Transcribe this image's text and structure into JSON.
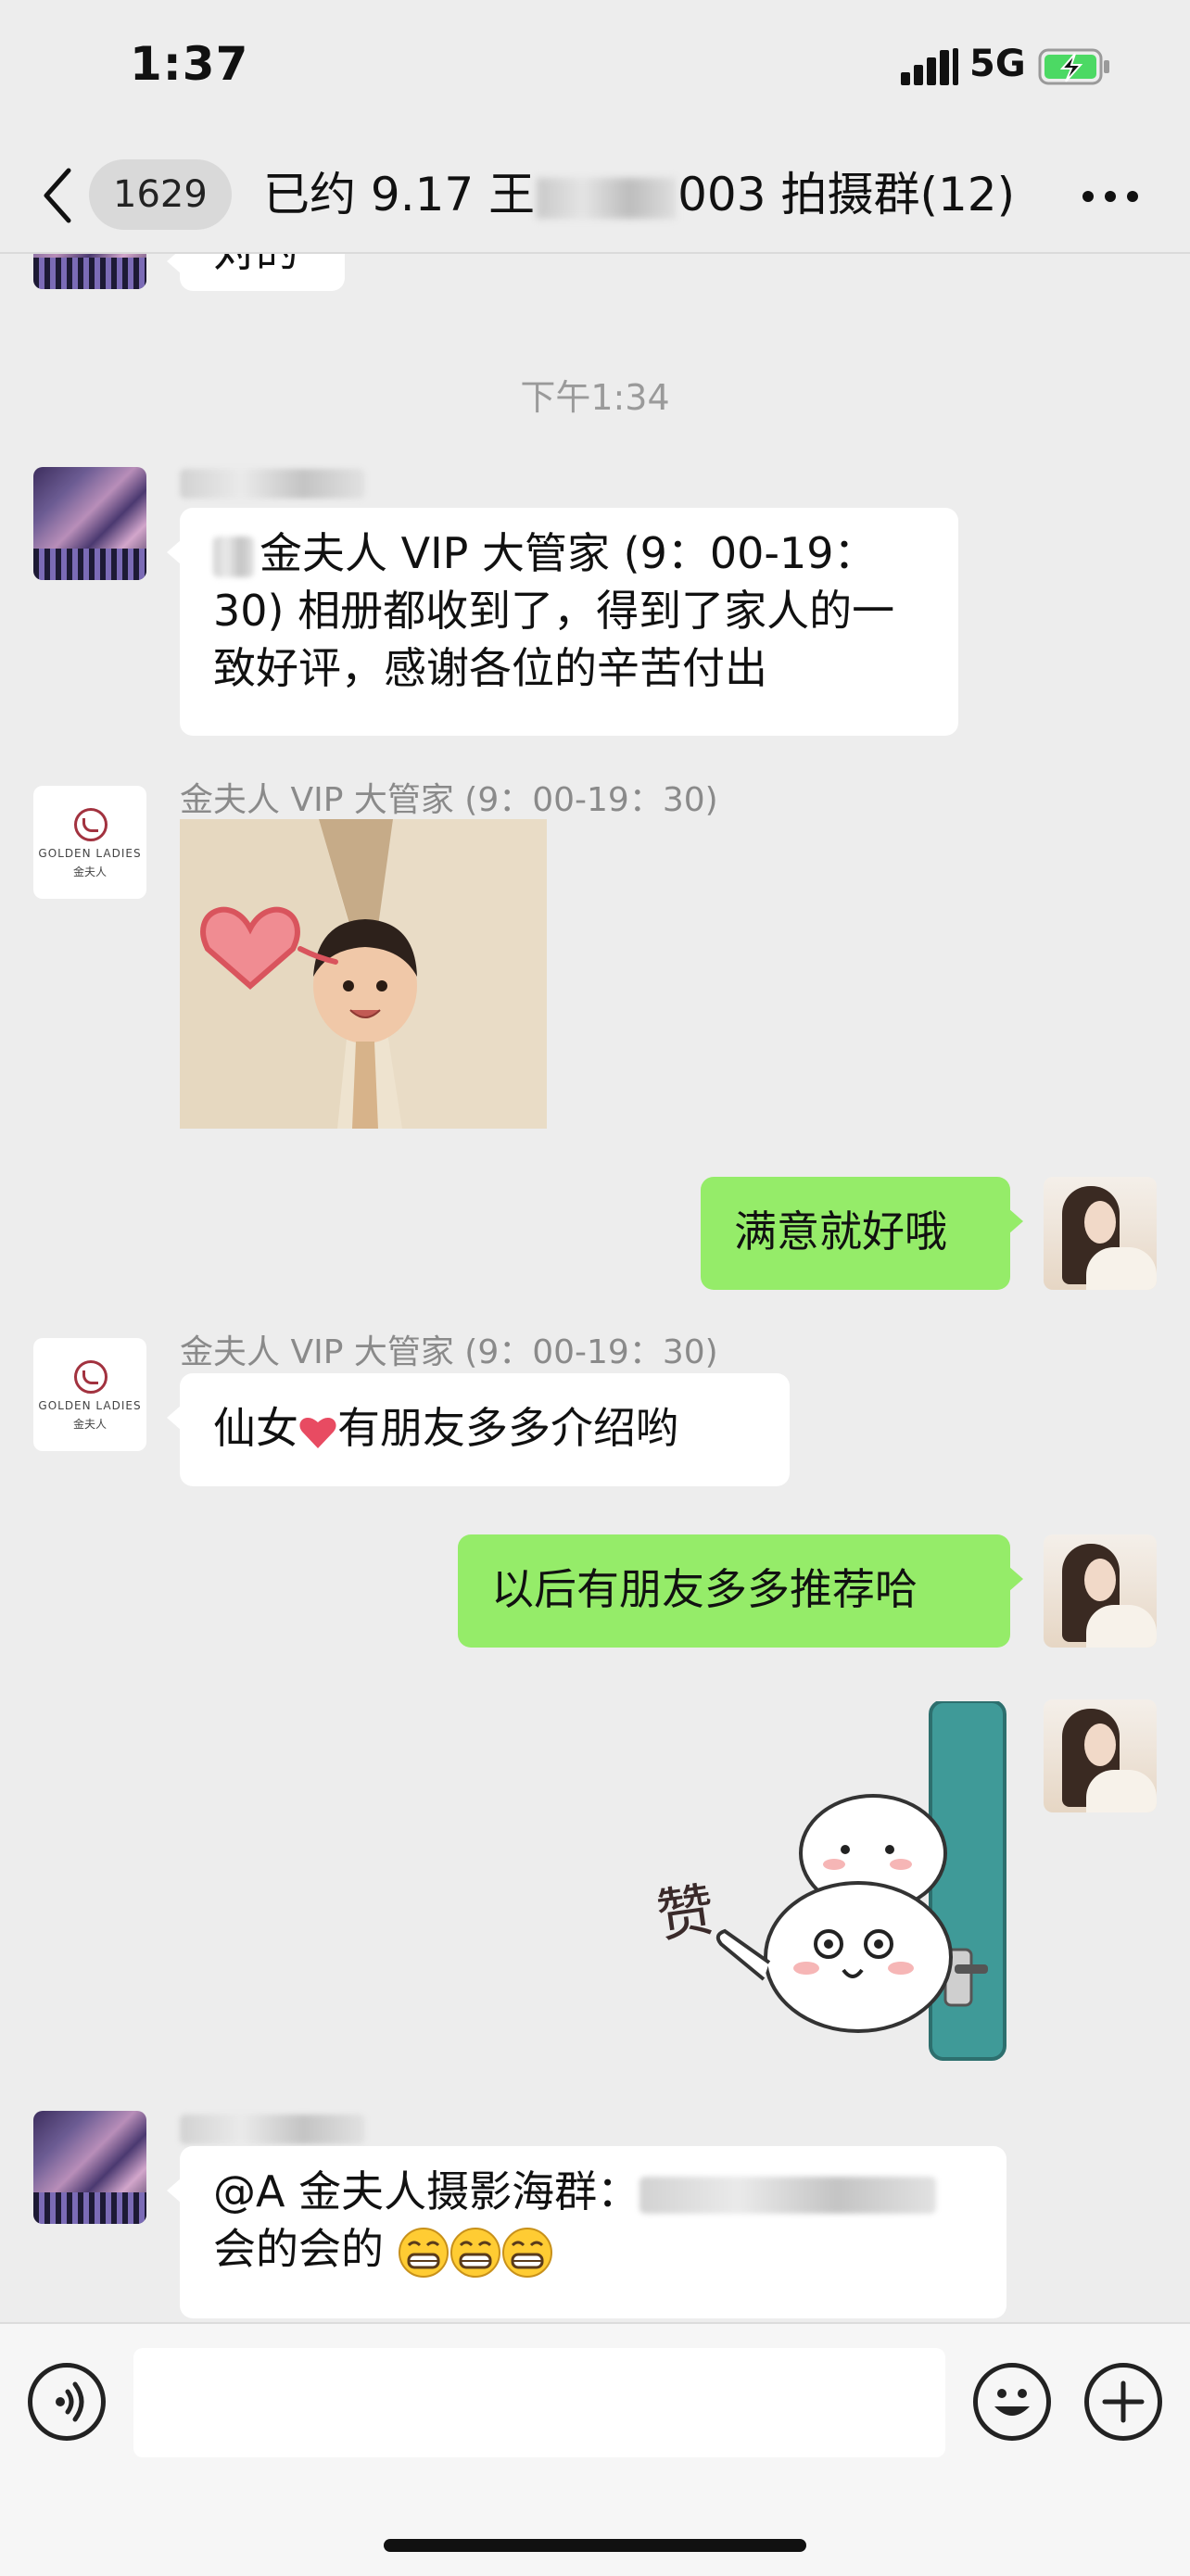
{
  "status": {
    "time": "1:37",
    "network": "5G"
  },
  "nav": {
    "unread_count": "1629",
    "title_prefix": "已约 9.17 王",
    "title_suffix": "003 拍摄群(12)"
  },
  "messages": {
    "partial_top_text": "对的",
    "time_separator": "下午1:34",
    "m1": {
      "text": "金夫人 VIP 大管家 (9：00-19：30) 相册都收到了，得到了家人的一致好评，感谢各位的辛苦付出"
    },
    "m2": {
      "sender": "金夫人 VIP 大管家 (9：00-19：30)"
    },
    "m3": {
      "text": "满意就好哦"
    },
    "m4": {
      "sender": "金夫人 VIP 大管家 (9：00-19：30)",
      "text_before": "仙女",
      "text_after": "有朋友多多介绍哟"
    },
    "m5": {
      "text": "以后有朋友多多推荐哈"
    },
    "m6": {
      "sticker_text": "赞"
    },
    "m7": {
      "mention": "@A 金夫人摄影海群：",
      "text": "会的会的"
    }
  },
  "logo": {
    "line1": "GOLDEN LADIES",
    "line2": "金夫人"
  },
  "input": {
    "placeholder": ""
  }
}
